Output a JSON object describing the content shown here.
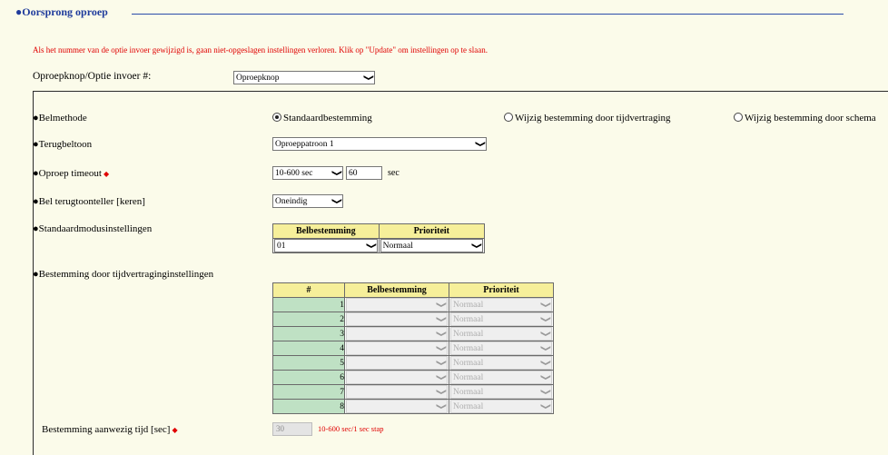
{
  "section": {
    "title": "●Oorsprong oproep"
  },
  "warning": "Als het nummer van de optie invoer gewijzigd is, gaan niet-opgeslagen instellingen verloren. Klik op \"Update\" om instellingen op te slaan.",
  "call_button": {
    "label": "Oproepknop/Optie invoer #:",
    "value": "Oproepknop"
  },
  "ring_method": {
    "label": "●Belmethode",
    "options": [
      {
        "label": "Standaardbestemming",
        "checked": true
      },
      {
        "label": "Wijzig bestemming door tijdvertraging",
        "checked": false
      },
      {
        "label": "Wijzig bestemming door schema",
        "checked": false
      }
    ]
  },
  "ringback": {
    "label": "●Terugbeltoon",
    "value": "Oproeppatroon 1"
  },
  "timeout": {
    "label": "●Oproep timeout",
    "range": "10-600 sec",
    "value": "60",
    "unit": "sec"
  },
  "ringback_count": {
    "label": "●Bel terugtoonteller [keren]",
    "value": "Oneindig"
  },
  "default_mode": {
    "label": "●Standaardmodusinstellingen",
    "headers": [
      "Belbestemming",
      "Prioriteit"
    ],
    "row": {
      "destination": "01",
      "priority": "Normaal"
    }
  },
  "delay_dest": {
    "label": "●Bestemming door tijdvertraginginstellingen",
    "headers": [
      "#",
      "Belbestemming",
      "Prioriteit"
    ],
    "rows": [
      {
        "n": "1",
        "priority": "Normaal"
      },
      {
        "n": "2",
        "priority": "Normaal"
      },
      {
        "n": "3",
        "priority": "Normaal"
      },
      {
        "n": "4",
        "priority": "Normaal"
      },
      {
        "n": "5",
        "priority": "Normaal"
      },
      {
        "n": "6",
        "priority": "Normaal"
      },
      {
        "n": "7",
        "priority": "Normaal"
      },
      {
        "n": "8",
        "priority": "Normaal"
      }
    ]
  },
  "presence_time": {
    "label": "Bestemming aanwezig tijd [sec]",
    "value": "30",
    "hint": "10-600 sec/1 sec stap"
  },
  "colors": {
    "accent": "#1f3b9c",
    "warning": "#e00000",
    "header_bg": "#f6ef9a",
    "index_bg": "#bfe1c4",
    "page_bg": "#fbfbea"
  }
}
